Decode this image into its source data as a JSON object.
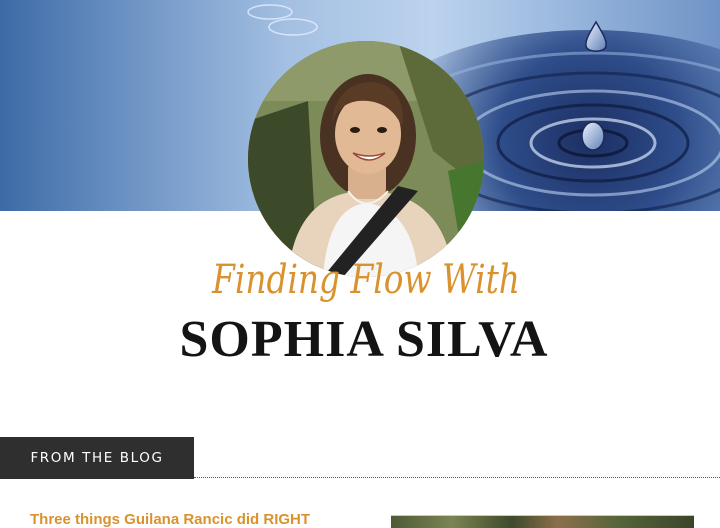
{
  "header": {
    "script_title": "Finding Flow With",
    "name": "SOPHIA SILVA"
  },
  "blog": {
    "tab_label": "FROM THE BLOG",
    "posts": [
      {
        "title": "Three things Guilana Rancic did RIGHT"
      }
    ]
  },
  "colors": {
    "accent": "#d9922e",
    "tab_background": "#2f2f2f",
    "title_text": "#141414"
  }
}
